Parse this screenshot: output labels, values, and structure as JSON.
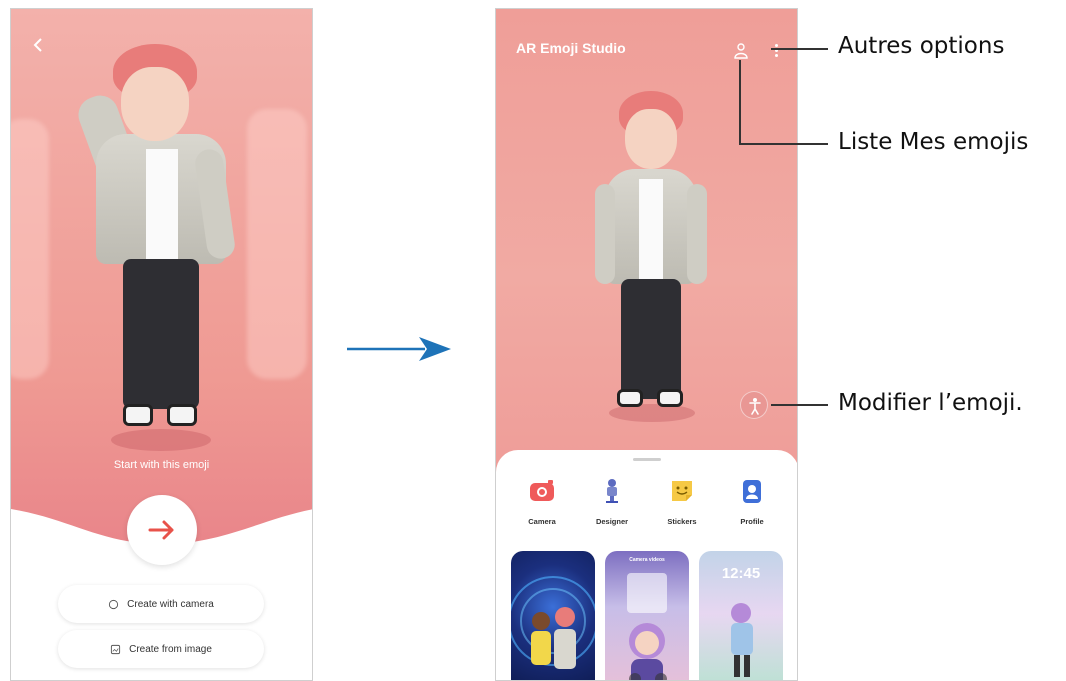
{
  "left_screen": {
    "back_icon": "chevron-left-icon",
    "prompt_text": "Start with this emoji",
    "next_button_icon": "arrow-right-icon",
    "create_camera_label": "Create with camera",
    "create_image_label": "Create from image"
  },
  "right_screen": {
    "app_title": "AR Emoji Studio",
    "tools": [
      {
        "label": "Camera",
        "icon": "camera-icon"
      },
      {
        "label": "Designer",
        "icon": "designer-icon"
      },
      {
        "label": "Stickers",
        "icon": "stickers-icon"
      },
      {
        "label": "Profile",
        "icon": "profile-icon"
      }
    ],
    "cards": [
      {
        "time": ""
      },
      {
        "time": "Camera videos"
      },
      {
        "time": "12:45"
      }
    ]
  },
  "callouts": {
    "more_options": "Autres options",
    "my_emojis_list": "Liste Mes emojis",
    "edit_emoji": "Modifier l’emoji."
  },
  "colors": {
    "brand_red": "#e8524a",
    "flow_arrow": "#1e73b8",
    "background_pink": "#ef9a93"
  }
}
